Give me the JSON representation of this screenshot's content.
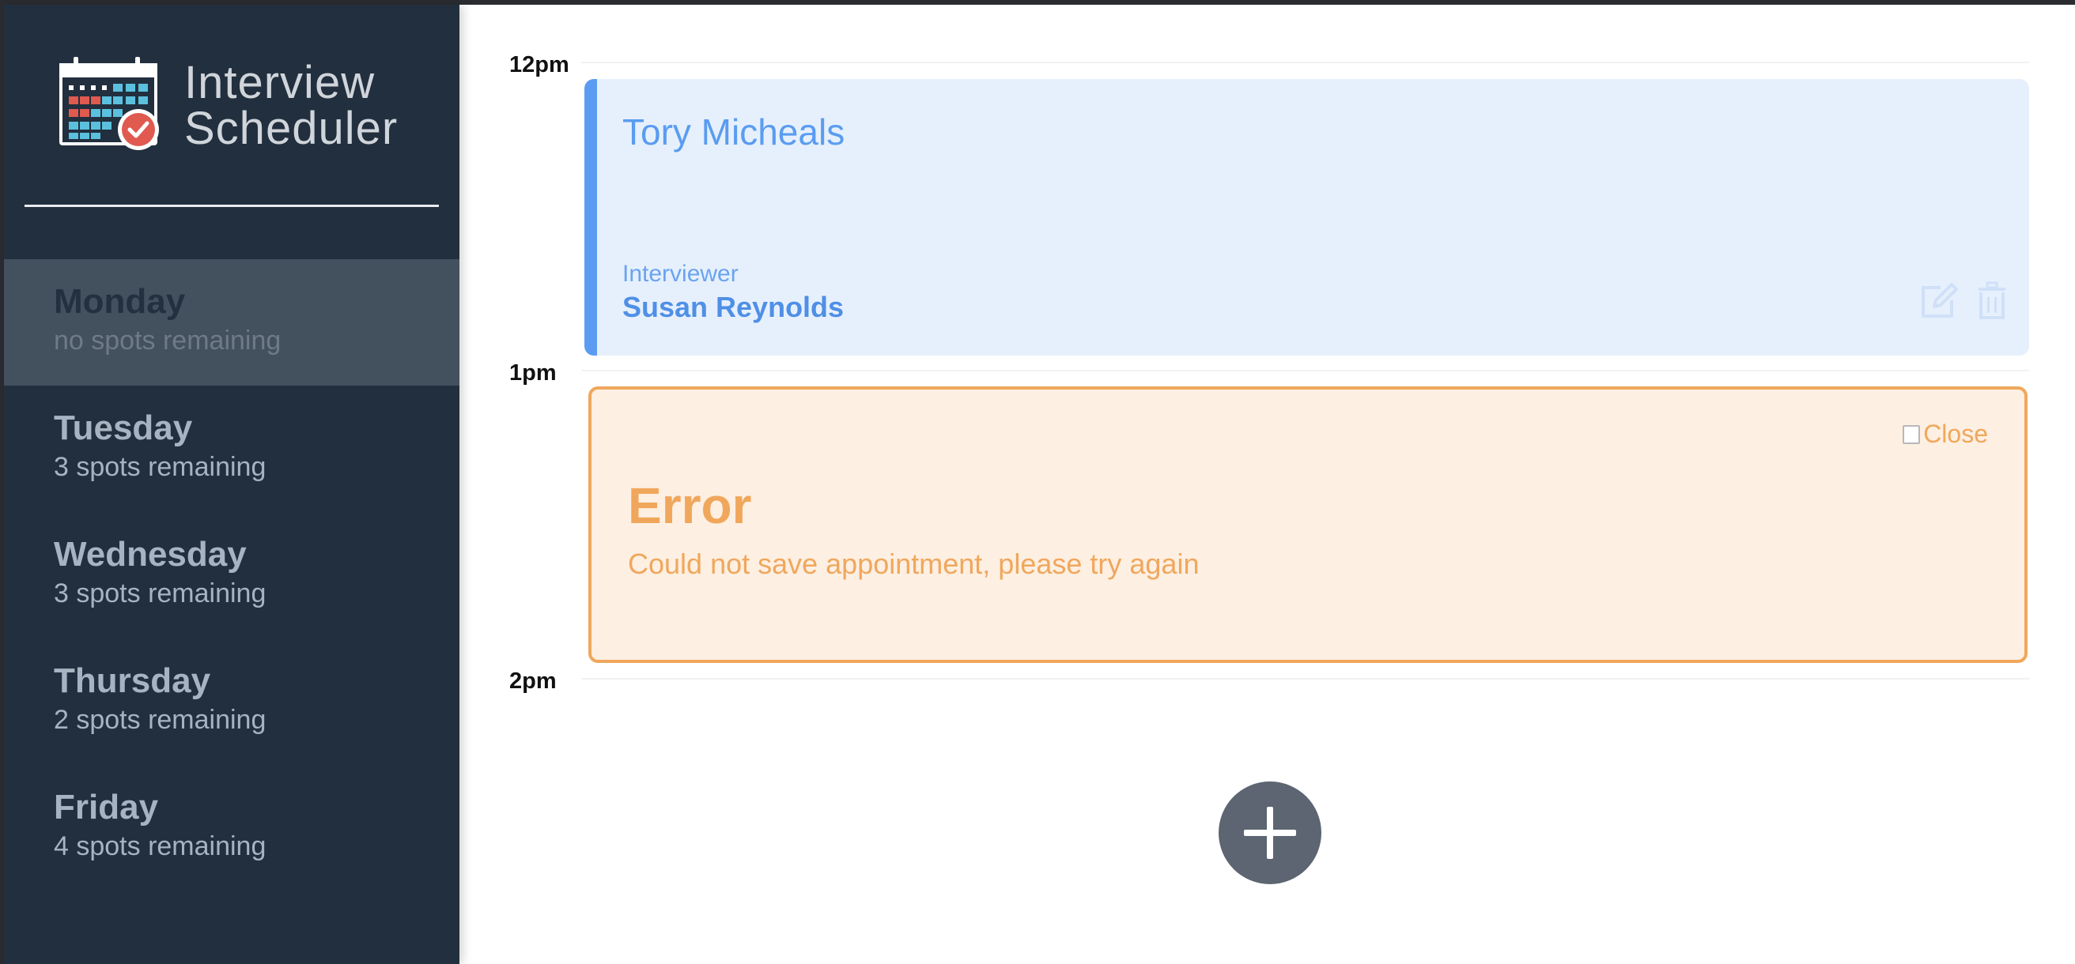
{
  "app": {
    "title_line1": "Interview",
    "title_line2": "Scheduler"
  },
  "days": [
    {
      "name": "Monday",
      "spots": "no spots remaining",
      "selected": true
    },
    {
      "name": "Tuesday",
      "spots": "3 spots remaining",
      "selected": false
    },
    {
      "name": "Wednesday",
      "spots": "3 spots remaining",
      "selected": false
    },
    {
      "name": "Thursday",
      "spots": "2 spots remaining",
      "selected": false
    },
    {
      "name": "Friday",
      "spots": "4 spots remaining",
      "selected": false
    }
  ],
  "times": [
    "12pm",
    "1pm",
    "2pm"
  ],
  "appointment": {
    "student": "Tory Micheals",
    "interviewer_label": "Interviewer",
    "interviewer": "Susan Reynolds",
    "edit_icon": "edit-icon",
    "delete_icon": "trash-icon"
  },
  "error": {
    "close_alt": "Close",
    "title": "Error",
    "message": "Could not save appointment, please try again"
  },
  "add_icon": "plus-icon",
  "colors": {
    "sidebar": "#222f3e",
    "selected_day": "#43505e",
    "appointment_bg": "#e6f0fd",
    "appointment_accent": "#5b9cf2",
    "error_bg": "#fdefe2",
    "error_accent": "#f0a75c",
    "add_button": "#5c6571"
  }
}
